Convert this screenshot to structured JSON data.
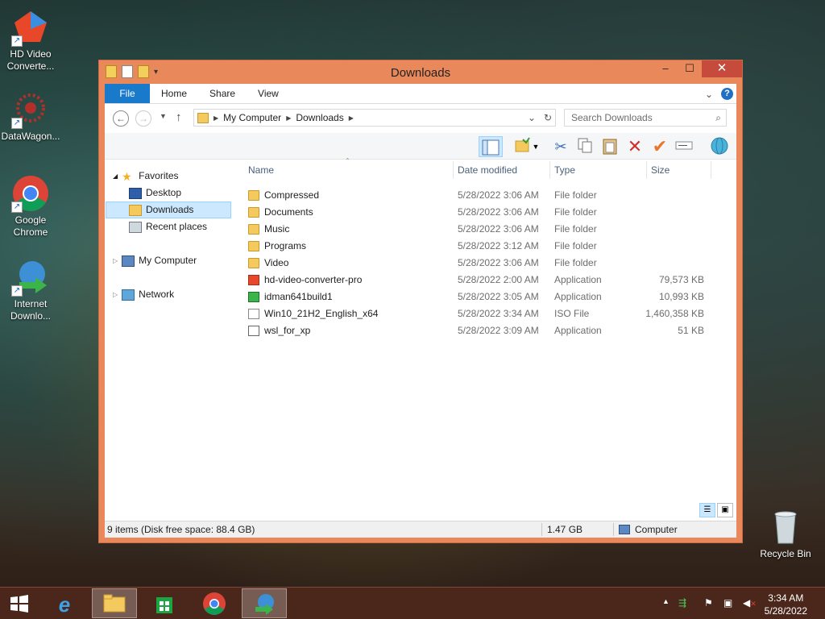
{
  "desktop": {
    "icons": [
      {
        "label1": "HD Video",
        "label2": "Converte..."
      },
      {
        "label1": "DataWagon...",
        "label2": ""
      },
      {
        "label1": "Google",
        "label2": "Chrome"
      },
      {
        "label1": "Internet",
        "label2": "Downlo..."
      }
    ],
    "recycle_bin": "Recycle Bin"
  },
  "window": {
    "title": "Downloads",
    "minimize": "–",
    "maximize": "☐",
    "close": "✕",
    "accent": "#e9895b"
  },
  "ribbon": {
    "tabs": [
      "File",
      "Home",
      "Share",
      "View"
    ],
    "help": "?"
  },
  "address": {
    "crumbs": [
      "My Computer",
      "Downloads"
    ],
    "search_placeholder": "Search Downloads"
  },
  "nav": {
    "favorites": "Favorites",
    "desktop": "Desktop",
    "downloads": "Downloads",
    "recent": "Recent places",
    "computer": "My Computer",
    "network": "Network"
  },
  "columns": {
    "name": "Name",
    "date": "Date modified",
    "type": "Type",
    "size": "Size"
  },
  "files": [
    {
      "name": "Compressed",
      "date": "5/28/2022 3:06 AM",
      "type": "File folder",
      "size": "",
      "kind": "folder"
    },
    {
      "name": "Documents",
      "date": "5/28/2022 3:06 AM",
      "type": "File folder",
      "size": "",
      "kind": "folder"
    },
    {
      "name": "Music",
      "date": "5/28/2022 3:06 AM",
      "type": "File folder",
      "size": "",
      "kind": "folder"
    },
    {
      "name": "Programs",
      "date": "5/28/2022 3:12 AM",
      "type": "File folder",
      "size": "",
      "kind": "folder"
    },
    {
      "name": "Video",
      "date": "5/28/2022 3:06 AM",
      "type": "File folder",
      "size": "",
      "kind": "folder"
    },
    {
      "name": "hd-video-converter-pro",
      "date": "5/28/2022 2:00 AM",
      "type": "Application",
      "size": "79,573 KB",
      "kind": "app"
    },
    {
      "name": "idman641build1",
      "date": "5/28/2022 3:05 AM",
      "type": "Application",
      "size": "10,993 KB",
      "kind": "app"
    },
    {
      "name": "Win10_21H2_English_x64",
      "date": "5/28/2022 3:34 AM",
      "type": "ISO File",
      "size": "1,460,358 KB",
      "kind": "iso"
    },
    {
      "name": "wsl_for_xp",
      "date": "5/28/2022 3:09 AM",
      "type": "Application",
      "size": "51 KB",
      "kind": "app"
    }
  ],
  "footer": {
    "items_count": "9 items"
  },
  "status": {
    "left": "9 items (Disk free space: 88.4 GB)",
    "size": "1.47 GB",
    "location": "Computer"
  },
  "taskbar": {
    "time": "3:34 AM",
    "date": "5/28/2022"
  }
}
